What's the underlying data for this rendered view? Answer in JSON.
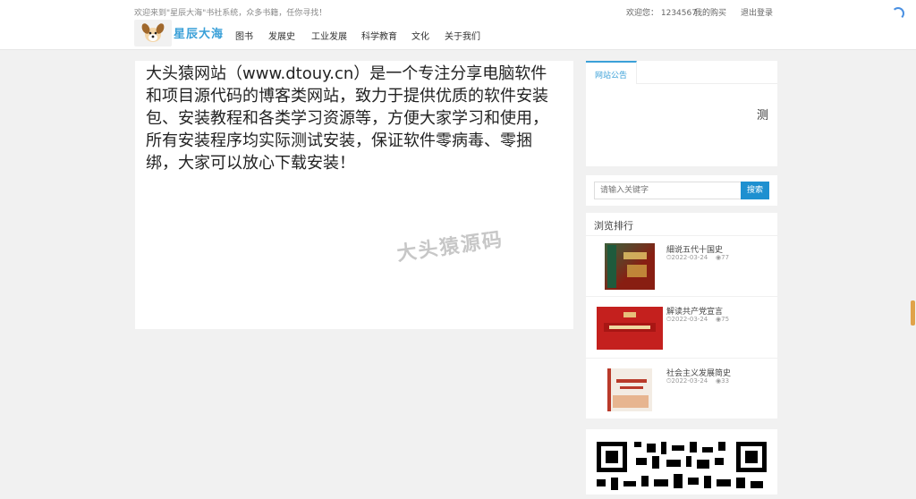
{
  "header": {
    "welcome": "欢迎来到\"星辰大海\"书社系统，众多书籍，任你寻找！",
    "greeting": "欢迎您： 1234567",
    "my_purchases": "我的购买",
    "logout": "退出登录",
    "logo_text": "星辰大海",
    "nav": [
      "图书",
      "发展史",
      "工业发展",
      "科学教育",
      "文化",
      "关于我们"
    ]
  },
  "main": {
    "intro": "大头猿网站（www.dtouy.cn）是一个专注分享电脑软件和项目源代码的博客类网站，致力于提供优质的软件安装包、安装教程和各类学习资源等，方便大家学习和使用，所有安装程序均实际测试安装，保证软件零病毒、零捆绑，大家可以放心下载安装！",
    "watermark": "大头猿源码"
  },
  "sidebar": {
    "notice_tab": "网站公告",
    "notice_body": "测",
    "search_placeholder": "请输入关键字",
    "search_button": "搜索",
    "ranking_title": "浏览排行",
    "ranking": [
      {
        "title": "細说五代十国史",
        "date": "2022-03-24",
        "views": "77"
      },
      {
        "title": "解读共产党宣言",
        "date": "2022-03-24",
        "views": "75"
      },
      {
        "title": "社会主义发展简史",
        "date": "2022-03-24",
        "views": "33"
      }
    ]
  },
  "colors": {
    "accent": "#3aa0d8",
    "search_button": "#1e90d0",
    "background": "#f1f1f1"
  }
}
